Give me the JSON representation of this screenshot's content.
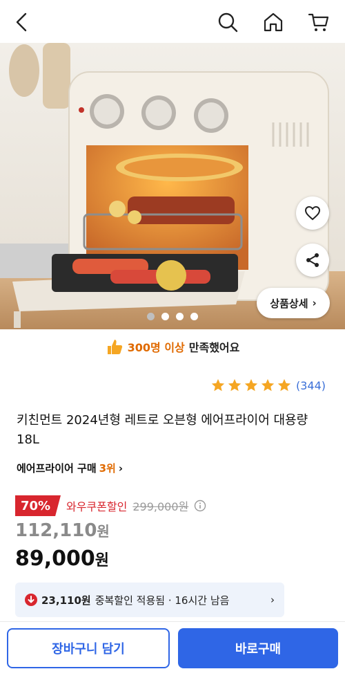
{
  "header": {
    "back_icon": "back-arrow-icon",
    "search_icon": "search-icon",
    "home_icon": "home-icon",
    "cart_icon": "cart-icon"
  },
  "gallery": {
    "total_images": 4,
    "current_index": 2,
    "detail_button_label": "상품상세",
    "wishlist_icon": "heart-icon",
    "share_icon": "share-icon"
  },
  "satisfaction": {
    "highlight": "300명 이상",
    "text": "만족했어요"
  },
  "rating": {
    "stars": 5,
    "count": "(344)"
  },
  "product": {
    "title": "키친먼트 2024년형 레트로 오븐형 에어프라이어 대용량 18L",
    "rank_prefix": "에어프라이어 구매",
    "rank_value": "3위"
  },
  "pricing": {
    "discount_pct": "70%",
    "coupon_label": "와우쿠폰할인",
    "original_price": "299,000원",
    "price_number": "112,110",
    "price_unit": "원",
    "final_number": "89,000",
    "final_unit": "원"
  },
  "extra_discount": {
    "amount": "23,110원",
    "text": "중복할인 적용됨 · 16시간 남음"
  },
  "actions": {
    "cart_label": "장바구니 담기",
    "buy_label": "바로구매"
  },
  "colors": {
    "accent": "#2f66e6",
    "discount_red": "#d8262e",
    "highlight_orange": "#e06a00",
    "star": "#f5a623"
  }
}
